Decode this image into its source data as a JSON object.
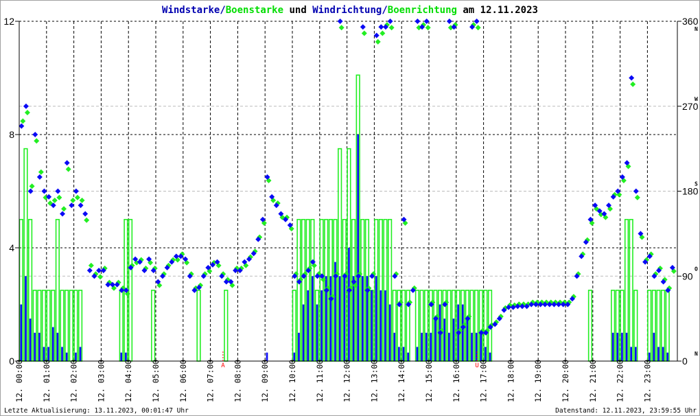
{
  "chart_data": {
    "type": "bar+scatter",
    "title_parts": [
      {
        "text": "Windstarke",
        "color": "#0000b0"
      },
      {
        "text": "/",
        "color": "#0000b0"
      },
      {
        "text": "Boenstarke",
        "color": "#00dd00"
      },
      {
        "text": " und ",
        "color": "#000000"
      },
      {
        "text": "Windrichtung",
        "color": "#0000b0"
      },
      {
        "text": "/",
        "color": "#0000b0"
      },
      {
        "text": "Boenrichtung",
        "color": "#00dd00"
      },
      {
        "text": " am 12.11.2023",
        "color": "#000000"
      }
    ],
    "ylim_left": [
      0,
      12
    ],
    "yticks_left": [
      "0",
      "4",
      "8",
      "12"
    ],
    "ylim_right": [
      0,
      360
    ],
    "yticks_right": [
      {
        "value": 0,
        "label": "0",
        "dir": "N"
      },
      {
        "value": 90,
        "label": "90",
        "dir": "O"
      },
      {
        "value": 180,
        "label": "180",
        "dir": "S"
      },
      {
        "value": 270,
        "label": "270",
        "dir": "W"
      },
      {
        "value": 360,
        "label": "360",
        "dir": "N"
      }
    ],
    "x_hours": [
      0,
      24
    ],
    "xtick_labels": [
      "12. 00:00",
      "12. 01:00",
      "12. 02:00",
      "12. 03:00",
      "12. 04:00",
      "12. 05:00",
      "12. 06:00",
      "12. 07:00",
      "12. 08:00",
      "12. 09:00",
      "12. 10:00",
      "12. 11:00",
      "12. 12:00",
      "12. 13:00",
      "12. 14:00",
      "12. 15:00",
      "12. 16:00",
      "12. 17:00",
      "12. 18:00",
      "12. 19:00",
      "12. 20:00",
      "12. 21:00",
      "12. 22:00",
      "12. 23:00"
    ],
    "interval_minutes": 10,
    "colors": {
      "wind": "#0a0af5",
      "gust": "#22ee22",
      "grid": "#000000",
      "grid_light": "#bbbbbb",
      "marker": "#ff0000"
    },
    "series": [
      {
        "name": "Windstarke",
        "kind": "bar",
        "values": [
          2,
          3,
          1.5,
          1,
          1,
          0.5,
          0.5,
          1.2,
          1,
          0.5,
          0.3,
          0,
          0.3,
          0.5,
          0,
          0,
          0,
          0,
          0,
          0,
          0,
          0,
          0.3,
          0.3,
          0,
          0,
          0,
          0,
          0,
          0,
          0,
          0,
          0,
          0,
          0,
          0,
          0,
          0,
          0,
          0,
          0,
          0,
          0,
          0,
          0,
          0,
          0,
          0,
          0,
          0,
          0,
          0,
          0,
          0,
          0.3,
          0,
          0,
          0,
          0,
          0,
          0.3,
          1,
          2,
          2.5,
          3,
          2,
          2.5,
          3,
          3,
          3.5,
          3,
          3,
          4,
          3,
          8,
          3,
          3,
          2.5,
          3,
          2.5,
          2.5,
          2,
          1,
          0.5,
          0.5,
          0.3,
          0,
          0.5,
          1,
          1,
          1,
          1.5,
          2,
          1.5,
          1,
          1.5,
          2,
          2,
          1.5,
          1,
          1,
          1,
          0.5,
          0.3,
          0,
          0,
          0,
          0,
          0,
          0,
          0,
          0,
          0,
          0,
          0,
          0,
          0,
          0,
          0,
          0,
          0,
          0,
          0,
          0,
          0,
          0,
          0,
          0,
          0,
          0,
          1,
          1,
          1,
          1,
          0.5,
          0.5,
          0,
          0,
          0.3,
          1,
          0.5,
          0.5,
          0.3,
          0
        ]
      },
      {
        "name": "Boenstarke",
        "kind": "bar",
        "values": [
          5,
          7.5,
          5,
          2.5,
          2.5,
          2.5,
          2.5,
          2.5,
          5,
          2.5,
          2.5,
          2.5,
          2.5,
          2.5,
          0,
          0,
          0,
          0,
          0,
          0,
          0,
          0,
          2.5,
          5,
          5,
          0,
          0,
          0,
          0,
          2.5,
          0,
          0,
          0,
          0,
          0,
          0,
          0,
          0,
          0,
          2.5,
          0,
          0,
          0,
          0,
          0,
          2.5,
          0,
          0,
          0,
          0,
          0,
          0,
          0,
          0,
          0,
          0,
          0,
          0,
          0,
          0,
          2.5,
          5,
          5,
          5,
          5,
          2.5,
          5,
          5,
          5,
          5,
          7.5,
          5,
          7.5,
          5,
          10.1,
          5,
          5,
          2.5,
          5,
          5,
          5,
          5,
          2.5,
          2.5,
          2.5,
          2.5,
          0,
          2.5,
          2.5,
          2.5,
          2.5,
          2.5,
          2.5,
          2.5,
          2.5,
          2.5,
          2.5,
          2.5,
          2.5,
          2.5,
          2.5,
          2.5,
          2.5,
          2.5,
          0,
          0,
          0,
          0,
          0,
          0,
          0,
          0,
          0,
          0,
          0,
          0,
          0,
          0,
          0,
          0,
          0,
          0,
          0,
          0,
          0,
          2.5,
          0,
          0,
          0,
          0,
          2.5,
          2.5,
          2.5,
          5,
          5,
          2.5,
          0,
          0,
          2.5,
          2.5,
          2.5,
          2.5,
          2.5,
          0
        ]
      },
      {
        "name": "Windrichtung",
        "kind": "scatter",
        "unit": "deg",
        "values": [
          249,
          270,
          180,
          240,
          195,
          180,
          174,
          165,
          180,
          156,
          210,
          165,
          180,
          165,
          156,
          96,
          90,
          96,
          96,
          81,
          81,
          81,
          75,
          75,
          99,
          108,
          105,
          96,
          108,
          96,
          84,
          90,
          99,
          105,
          111,
          111,
          108,
          90,
          75,
          78,
          90,
          99,
          102,
          105,
          90,
          84,
          84,
          96,
          96,
          105,
          108,
          114,
          129,
          150,
          195,
          174,
          165,
          156,
          150,
          144,
          90,
          84,
          90,
          96,
          105,
          90,
          90,
          75,
          66,
          90,
          360,
          90,
          75,
          84,
          90,
          354,
          75,
          90,
          345,
          354,
          354,
          360,
          90,
          60,
          150,
          60,
          75,
          360,
          354,
          360,
          60,
          45,
          30,
          60,
          360,
          354,
          30,
          36,
          45,
          354,
          360,
          30,
          30,
          36,
          39,
          45,
          54,
          57,
          57,
          58,
          58,
          58,
          60,
          60,
          60,
          60,
          60,
          60,
          60,
          60,
          60,
          66,
          90,
          111,
          126,
          150,
          165,
          159,
          156,
          165,
          174,
          180,
          195,
          210,
          300,
          180,
          135,
          105,
          111,
          90,
          96,
          84,
          75,
          99
        ]
      },
      {
        "name": "Boenrichtung",
        "kind": "scatter",
        "unit": "deg",
        "values": [
          255,
          264,
          186,
          234,
          201,
          174,
          168,
          171,
          174,
          162,
          204,
          171,
          174,
          171,
          150,
          102,
          93,
          90,
          99,
          84,
          78,
          84,
          78,
          72,
          102,
          105,
          108,
          99,
          105,
          99,
          81,
          93,
          102,
          108,
          108,
          114,
          105,
          93,
          78,
          81,
          93,
          96,
          105,
          102,
          93,
          87,
          81,
          99,
          99,
          102,
          111,
          117,
          132,
          147,
          192,
          171,
          168,
          153,
          153,
          141,
          93,
          87,
          93,
          99,
          102,
          93,
          87,
          78,
          69,
          93,
          354,
          93,
          78,
          81,
          93,
          348,
          78,
          93,
          339,
          348,
          357,
          354,
          93,
          63,
          147,
          63,
          78,
          354,
          357,
          354,
          63,
          48,
          33,
          63,
          354,
          357,
          33,
          39,
          48,
          357,
          354,
          33,
          33,
          39,
          42,
          48,
          57,
          60,
          60,
          61,
          61,
          61,
          63,
          63,
          63,
          63,
          63,
          63,
          63,
          63,
          63,
          69,
          93,
          114,
          129,
          147,
          162,
          156,
          153,
          162,
          177,
          177,
          192,
          207,
          294,
          174,
          132,
          108,
          114,
          93,
          99,
          87,
          78,
          96
        ]
      }
    ],
    "markers": [
      {
        "label": "A",
        "hour": 7.46
      },
      {
        "label": "U",
        "hour": 16.76
      }
    ]
  },
  "footer": {
    "left": "Letzte Aktualisierung: 13.11.2023, 00:01:47 Uhr",
    "right": "Datenstand: 12.11.2023, 23:59:55 Uhr"
  }
}
